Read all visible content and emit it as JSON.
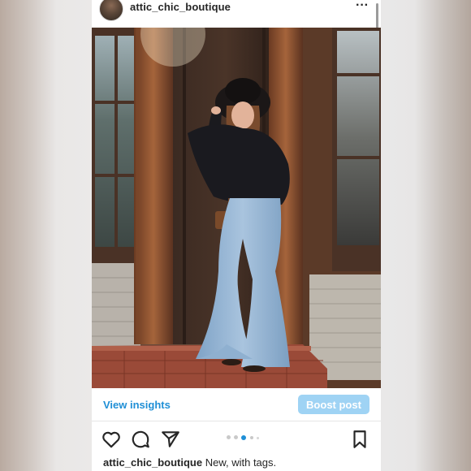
{
  "post": {
    "username": "attic_chic_boutique",
    "more_icon": "more-horizontal-icon",
    "insights_label": "View insights",
    "boost_label": "Boost post",
    "caption_username": "attic_chic_boutique",
    "caption_text": "New, with tags.",
    "carousel": {
      "total": 5,
      "active": 3
    },
    "colors": {
      "link_blue": "#1f8fd6",
      "boost_button": "#9fd3f4",
      "text": "#262626"
    }
  },
  "actions": {
    "like_icon": "heart-icon",
    "comment_icon": "comment-icon",
    "share_icon": "send-icon",
    "save_icon": "bookmark-icon"
  }
}
